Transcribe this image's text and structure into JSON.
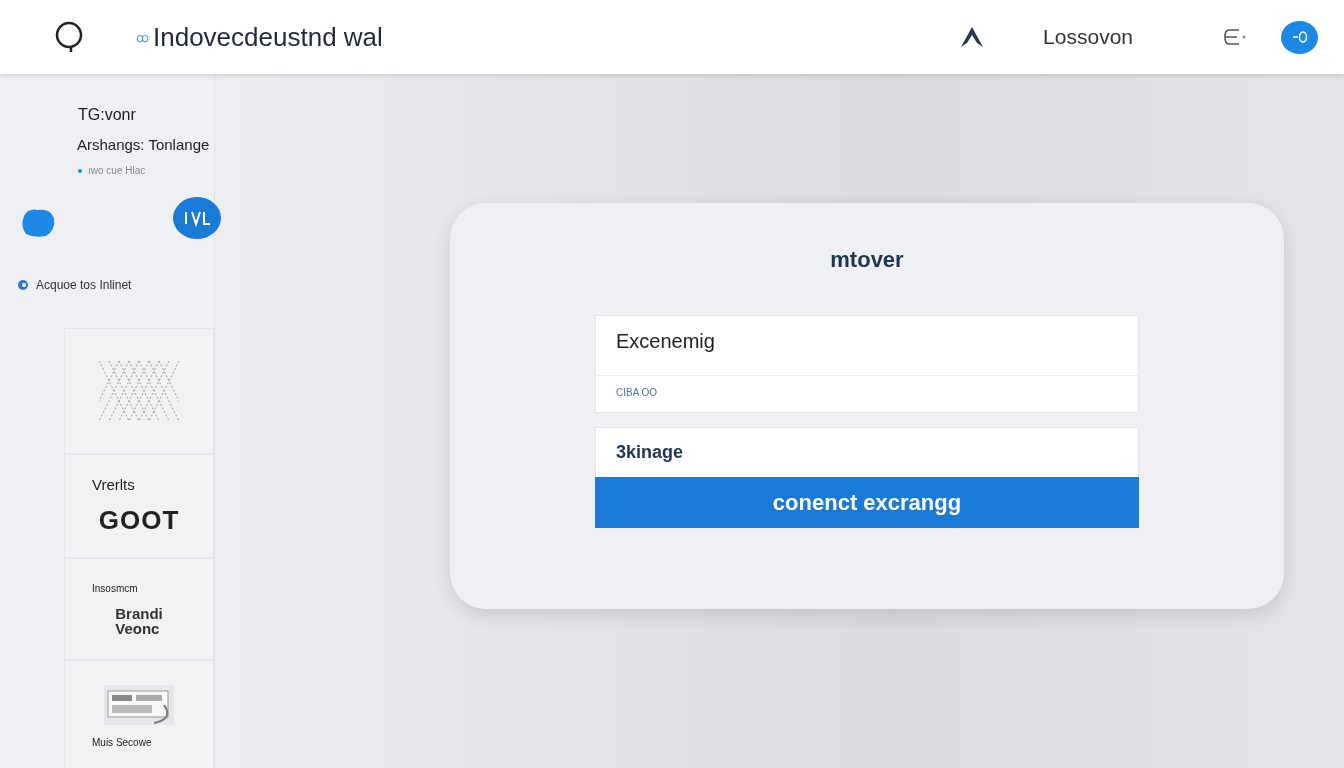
{
  "header": {
    "brand_mark": "ꝏ",
    "brand": "Indovecdeustnd wal",
    "account": "Lossovon"
  },
  "sidebar": {
    "title": "TG:vonr",
    "subtitle": "Arshangs: Tonlange",
    "note": "ıwo cue Hlac",
    "link": "Acquoe tos Inlinet",
    "cards": [
      {
        "kind": "pattern"
      },
      {
        "kind": "logo",
        "label": "Vrerlts",
        "logo": "GOOT"
      },
      {
        "kind": "brand",
        "label": "Insosmcm",
        "logo_top": "Brandi",
        "logo_bottom": "Veonc"
      },
      {
        "kind": "picture",
        "label": "Muis Secowe"
      }
    ]
  },
  "dialog": {
    "title": "mtover",
    "field_value": "Excenemig",
    "field_hint": "CIBA OO",
    "second_value": "3kinage",
    "button": "conenct excrangg"
  }
}
